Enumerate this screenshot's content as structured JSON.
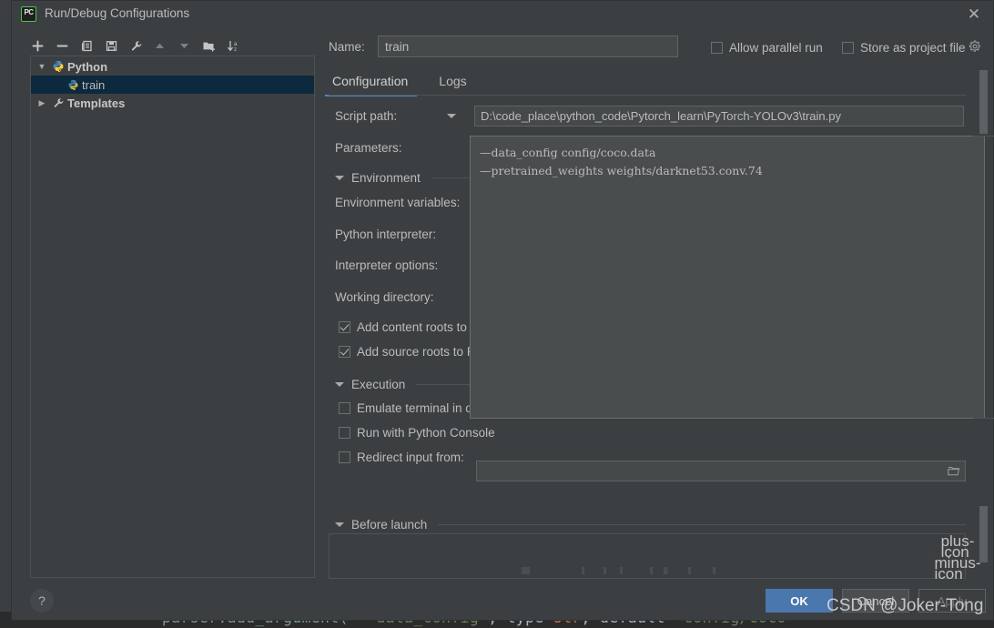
{
  "window": {
    "title": "Run/Debug Configurations",
    "app_icon": "pycharm-icon",
    "close_label": "✕"
  },
  "toolbar": {
    "buttons": [
      {
        "name": "add-configuration-button",
        "icon": "plus-icon"
      },
      {
        "name": "remove-configuration-button",
        "icon": "minus-icon"
      },
      {
        "name": "copy-configuration-button",
        "icon": "copy-icon"
      },
      {
        "name": "save-configuration-button",
        "icon": "save-icon"
      },
      {
        "name": "edit-templates-button",
        "icon": "wrench-icon"
      },
      {
        "name": "move-up-button",
        "icon": "arrow-up-icon"
      },
      {
        "name": "move-down-button",
        "icon": "arrow-down-icon"
      },
      {
        "name": "new-folder-button",
        "icon": "folder-add-icon"
      },
      {
        "name": "sort-configurations-button",
        "icon": "sort-az-icon"
      }
    ]
  },
  "tree": {
    "nodes": [
      {
        "label": "Python",
        "icon": "python-icon",
        "expanded": true,
        "selected": false,
        "triangle": "▼"
      },
      {
        "label": "train",
        "icon": "python-icon",
        "child": true,
        "selected": true,
        "triangle": ""
      },
      {
        "label": "Templates",
        "icon": "wrench-icon",
        "expanded": false,
        "selected": false,
        "triangle": "▶"
      }
    ]
  },
  "header": {
    "name_label": "Name:",
    "name_value": "train",
    "name_placeholder": "",
    "allow_parallel_run": "Allow parallel run",
    "store_as_project_file": "Store as project file",
    "gear_icon": "gear-icon"
  },
  "tabs": [
    {
      "label": "Configuration",
      "active": true
    },
    {
      "label": "Logs",
      "active": false
    }
  ],
  "form": {
    "script_path_label": "Script path:",
    "script_path_value": "D:\\code_place\\python_code\\Pytorch_learn\\PyTorch-YOLOv3\\train.py",
    "parameters_label": "Parameters:",
    "parameters_value_line1": "—data_config config/coco.data",
    "parameters_value_line2": "—pretrained_weights weights/darknet53.conv.74",
    "environment_section": "Environment",
    "environment_variables_label": "Environment variables:",
    "python_interpreter_label": "Python interpreter:",
    "interpreter_options_label": "Interpreter options:",
    "working_directory_label": "Working directory:",
    "add_content_roots_label": "Add content roots to",
    "add_source_roots_label": "Add source roots to P",
    "execution_section": "Execution",
    "emulate_terminal_label": "Emulate terminal in output console",
    "run_with_python_console_label": "Run with Python Console",
    "redirect_input_label": "Redirect input from:",
    "redirect_input_value": "",
    "before_launch_section": "Before launch",
    "browse_icon": "folder-browse-icon",
    "add_task_icon": "plus-icon",
    "remove_task_icon": "minus-icon"
  },
  "footer": {
    "help_label": "?",
    "ok_label": "OK",
    "cancel_label": "Cancel",
    "apply_label": "Apply"
  },
  "watermark": "CSDN @Joker-Tong",
  "background_code": {
    "part1": "parser.add_argument(",
    "part2": "\"--data_config\"",
    "part3": ", type=",
    "part4": "str",
    "part5": ", default=",
    "part6": "\"config/coco"
  },
  "colors": {
    "accent_blue": "#4a88c7",
    "ok_button": "#4a77ad",
    "selection": "#0d293e",
    "panel_bg": "#3c3f41",
    "field_bg": "#45494a",
    "border": "#4e5254"
  }
}
